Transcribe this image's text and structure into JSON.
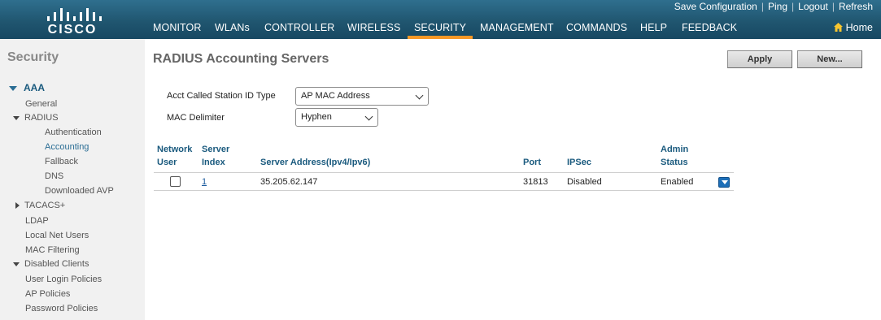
{
  "brand": {
    "logo_text": "CISCO"
  },
  "util_links": [
    "Save Configuration",
    "Ping",
    "Logout",
    "Refresh"
  ],
  "nav": {
    "items": [
      "MONITOR",
      "WLANs",
      "CONTROLLER",
      "WIRELESS",
      "SECURITY",
      "MANAGEMENT",
      "COMMANDS",
      "HELP",
      "FEEDBACK"
    ],
    "active": "SECURITY",
    "home_label": "Home"
  },
  "sidebar": {
    "title": "Security",
    "items": [
      {
        "label": "AAA",
        "level": 1,
        "expanded": true
      },
      {
        "label": "General",
        "level": 2
      },
      {
        "label": "RADIUS",
        "level": 2,
        "expanded": true
      },
      {
        "label": "Authentication",
        "level": 3
      },
      {
        "label": "Accounting",
        "level": 3,
        "selected": true
      },
      {
        "label": "Fallback",
        "level": 3
      },
      {
        "label": "DNS",
        "level": 3
      },
      {
        "label": "Downloaded AVP",
        "level": 3
      },
      {
        "label": "TACACS+",
        "level": 2,
        "expanded": false
      },
      {
        "label": "LDAP",
        "level": 2
      },
      {
        "label": "Local Net Users",
        "level": 2
      },
      {
        "label": "MAC Filtering",
        "level": 2
      },
      {
        "label": "Disabled Clients",
        "level": 2,
        "expanded": true
      },
      {
        "label": "User Login Policies",
        "level": 2
      },
      {
        "label": "AP Policies",
        "level": 2
      },
      {
        "label": "Password Policies",
        "level": 2
      }
    ]
  },
  "page": {
    "title": "RADIUS Accounting Servers",
    "apply_label": "Apply",
    "new_label": "New..."
  },
  "form": {
    "called_station_label": "Acct Called Station ID Type",
    "called_station_value": "AP MAC Address",
    "mac_delimiter_label": "MAC Delimiter",
    "mac_delimiter_value": "Hyphen"
  },
  "table": {
    "headers": {
      "network_user_1": "Network",
      "network_user_2": "User",
      "server_index_1": "Server",
      "server_index_2": "Index",
      "server_address": "Server Address(Ipv4/Ipv6)",
      "port": "Port",
      "ipsec": "IPSec",
      "admin_status_1": "Admin",
      "admin_status_2": "Status"
    },
    "rows": [
      {
        "network_user": false,
        "index": "1",
        "address": "35.205.62.147",
        "port": "31813",
        "ipsec": "Disabled",
        "status": "Enabled"
      }
    ]
  },
  "colors": {
    "header_bg": "#205670",
    "active_tab_underline": "#f89826",
    "link": "#1a5a7e",
    "dropdown_icon": "#1d6fb8"
  }
}
